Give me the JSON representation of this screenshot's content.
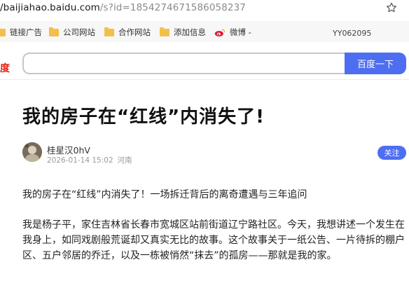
{
  "address_bar": {
    "url_host": "/baijiahao.baidu.com",
    "url_path": "/s?id=1854274671586058237"
  },
  "bookmarks": {
    "items": [
      {
        "label": "链接广告",
        "icon": "folder-icon"
      },
      {
        "label": "公司网站",
        "icon": "folder-icon"
      },
      {
        "label": "合作网站",
        "icon": "folder-icon"
      },
      {
        "label": "添加信息",
        "icon": "folder-icon"
      },
      {
        "label": "微博 -",
        "icon": "weibo-icon"
      }
    ],
    "right_label": "YY062095"
  },
  "search": {
    "logo_text": "度",
    "query": "",
    "button_label": "百度一下",
    "brand_color": "#4e6ef2"
  },
  "article": {
    "title": "我的房子在“红线”内消失了!",
    "author": "桂星汉0hV",
    "date": "2026-01-14 15:02",
    "location": "河南",
    "follow_label": "关注",
    "lead": "我的房子在“红线”内消失了！一场拆迁背后的离奇遭遇与三年追问",
    "paragraph": "我是杨子平，家住吉林省长春市宽城区站前街道辽宁路社区。今天，我想讲述一个发生在我身上，如同戏剧般荒诞却又真实无比的故事。这个故事关于一纸公告、一片待拆的棚户区、五户邻居的乔迁，以及一栋被悄然“抹去”的孤房——那就是我的家。"
  }
}
